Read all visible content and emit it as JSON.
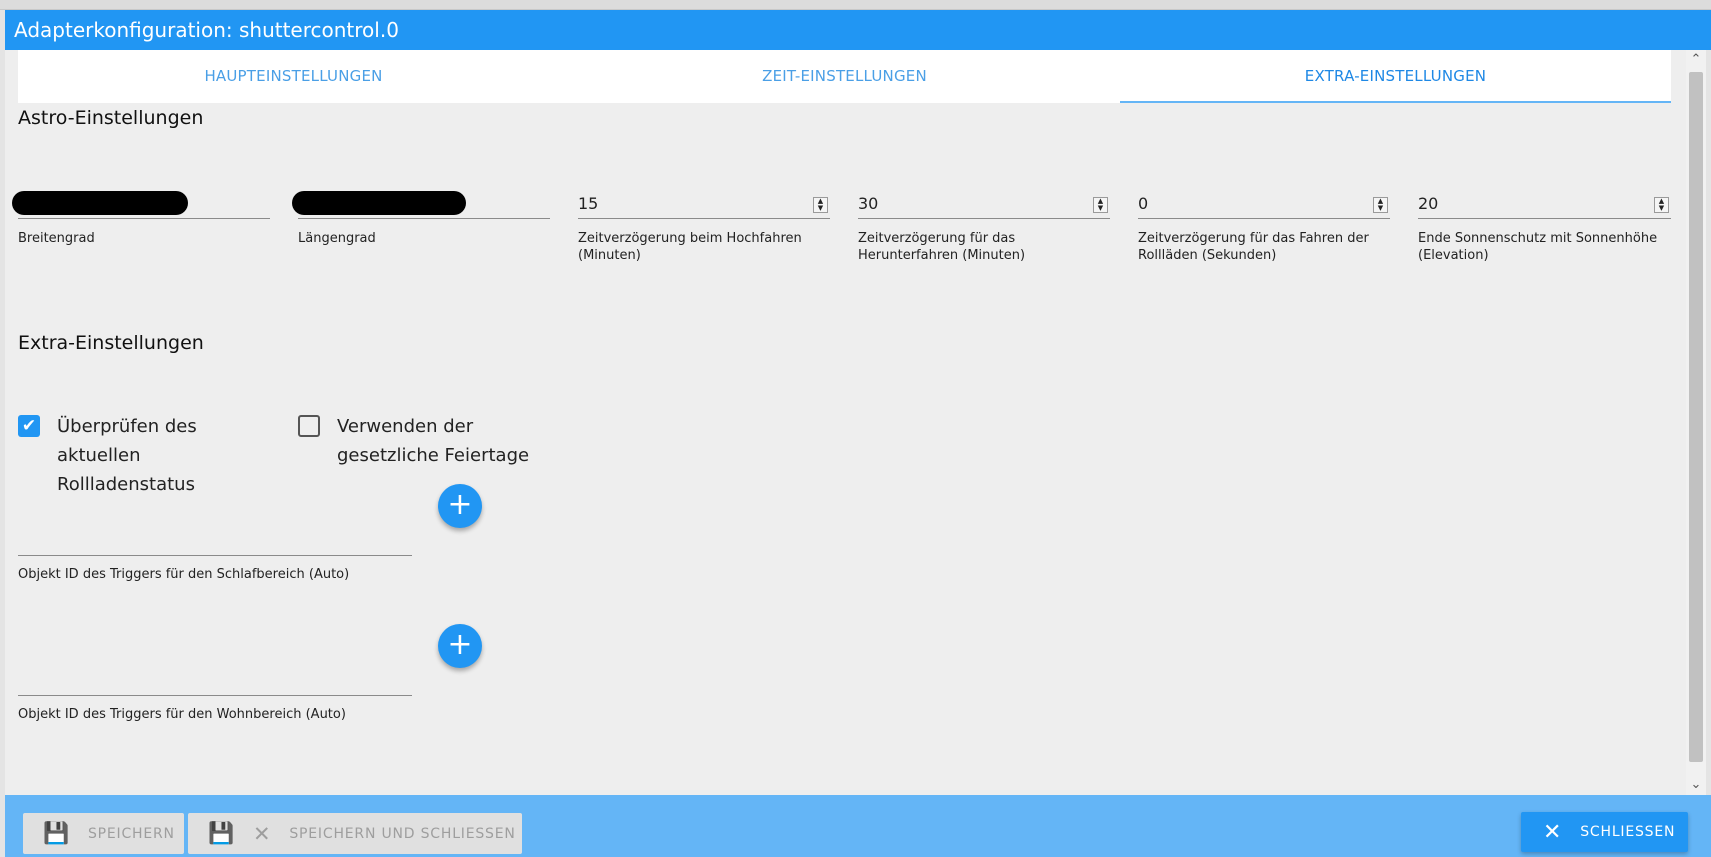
{
  "window": {
    "title": "Adapterkonfiguration: shuttercontrol.0"
  },
  "tabs": [
    {
      "label": "HAUPTEINSTELLUNGEN",
      "active": false
    },
    {
      "label": "ZEIT-EINSTELLUNGEN",
      "active": false
    },
    {
      "label": "EXTRA-EINSTELLUNGEN",
      "active": true
    }
  ],
  "astro": {
    "title": "Astro-Einstellungen",
    "fields": [
      {
        "label": "Breitengrad",
        "value": "",
        "redacted": true
      },
      {
        "label": "Längengrad",
        "value": "",
        "redacted": true
      },
      {
        "label": "Zeitverzögerung beim Hochfahren (Minuten)",
        "value": "15"
      },
      {
        "label": "Zeitverzögerung für das Herunterfahren (Minuten)",
        "value": "30"
      },
      {
        "label": "Zeitverzögerung für das Fahren der Rollläden (Sekunden)",
        "value": "0"
      },
      {
        "label": "Ende Sonnenschutz mit Sonnenhöhe (Elevation)",
        "value": "20"
      }
    ]
  },
  "extra": {
    "title": "Extra-Einstellungen",
    "checkboxes": [
      {
        "label": "Überprüfen des aktuellen Rollladenstatus",
        "checked": true
      },
      {
        "label": "Verwenden der gesetzliche Feiertage",
        "checked": false
      }
    ],
    "object_ids": [
      {
        "label": "Objekt ID des Triggers für den Schlafbereich (Auto)",
        "value": ""
      },
      {
        "label": "Objekt ID des Triggers für den Wohnbereich (Auto)",
        "value": ""
      }
    ]
  },
  "footer": {
    "save_label": "SPEICHERN",
    "save_close_label": "SPEICHERN UND SCHLIESSEN",
    "close_label": "SCHLIESSEN"
  },
  "colors": {
    "primary": "#2196f3",
    "footer": "#64b5f6",
    "content_bg": "#eeeeee"
  },
  "icons": {
    "save": "floppy-disk-icon",
    "close": "close-icon",
    "add": "plus-icon",
    "check": "checkmark-icon",
    "spinner": "spin-button-icon"
  }
}
